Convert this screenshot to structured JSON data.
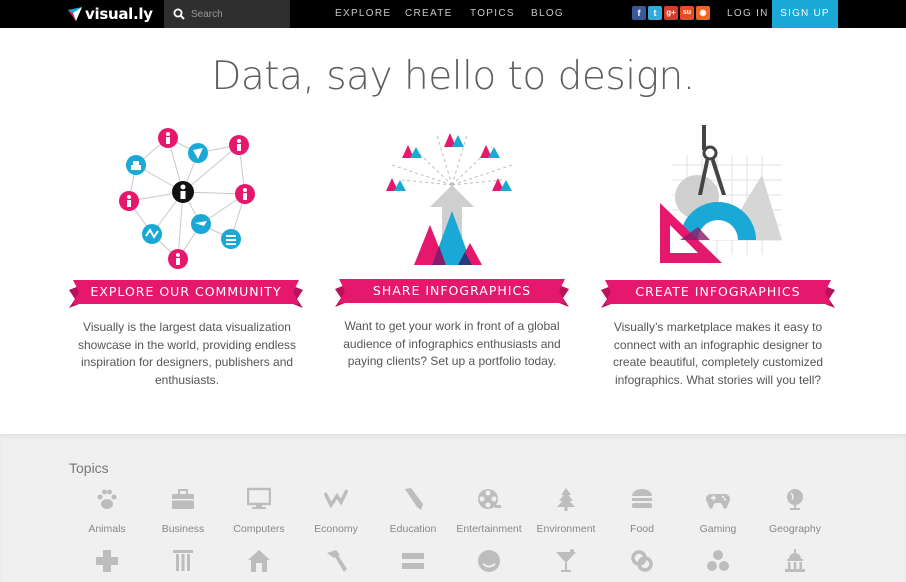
{
  "nav": {
    "logo_text": "visual.ly",
    "search_placeholder": "Search",
    "links": [
      "EXPLORE",
      "CREATE",
      "TOPICS",
      "BLOG"
    ],
    "social": [
      {
        "name": "facebook",
        "glyph": "f",
        "color": "#3b5998"
      },
      {
        "name": "twitter",
        "glyph": "t",
        "color": "#33a9dd"
      },
      {
        "name": "google-plus",
        "glyph": "g+",
        "color": "#d43d2a"
      },
      {
        "name": "stumbleupon",
        "glyph": "su",
        "color": "#ea4b24"
      },
      {
        "name": "rss",
        "glyph": "◉",
        "color": "#f26522"
      }
    ],
    "login": "LOG IN",
    "signup": "SIGN UP"
  },
  "headline": "Data, say hello to design.",
  "features": [
    {
      "title": "EXPLORE OUR COMMUNITY",
      "text": "Visually is the largest data visualization showcase in the world, providing endless inspiration for designers, publishers and enthusiasts."
    },
    {
      "title": "SHARE INFOGRAPHICS",
      "text": "Want to get your work in front of a global audience of infographics enthusiasts and paying clients? Set up a portfolio today."
    },
    {
      "title": "CREATE INFOGRAPHICS",
      "text": "Visually’s marketplace makes it easy to connect with an infographic designer to create beautiful, completely customized infographics. What stories will you tell?"
    }
  ],
  "topics": {
    "title": "Topics",
    "row1": [
      {
        "label": "Animals",
        "icon": "paw-icon"
      },
      {
        "label": "Business",
        "icon": "briefcase-icon"
      },
      {
        "label": "Computers",
        "icon": "monitor-icon"
      },
      {
        "label": "Economy",
        "icon": "trend-icon"
      },
      {
        "label": "Education",
        "icon": "pencil-icon"
      },
      {
        "label": "Entertainment",
        "icon": "film-reel-icon"
      },
      {
        "label": "Environment",
        "icon": "tree-icon"
      },
      {
        "label": "Food",
        "icon": "burger-icon"
      },
      {
        "label": "Gaming",
        "icon": "gamepad-icon"
      },
      {
        "label": "Geography",
        "icon": "globe-icon"
      }
    ],
    "row2_icons": [
      "cross-icon",
      "column-icon",
      "house-icon",
      "hammer-icon",
      "equals-icon",
      "smile-icon",
      "cocktail-icon",
      "link-icon",
      "dots-icon",
      "capitol-icon"
    ]
  },
  "colors": {
    "brand_pink": "#e5186d",
    "brand_blue": "#1aa9d6",
    "nav_bg": "#000000"
  }
}
